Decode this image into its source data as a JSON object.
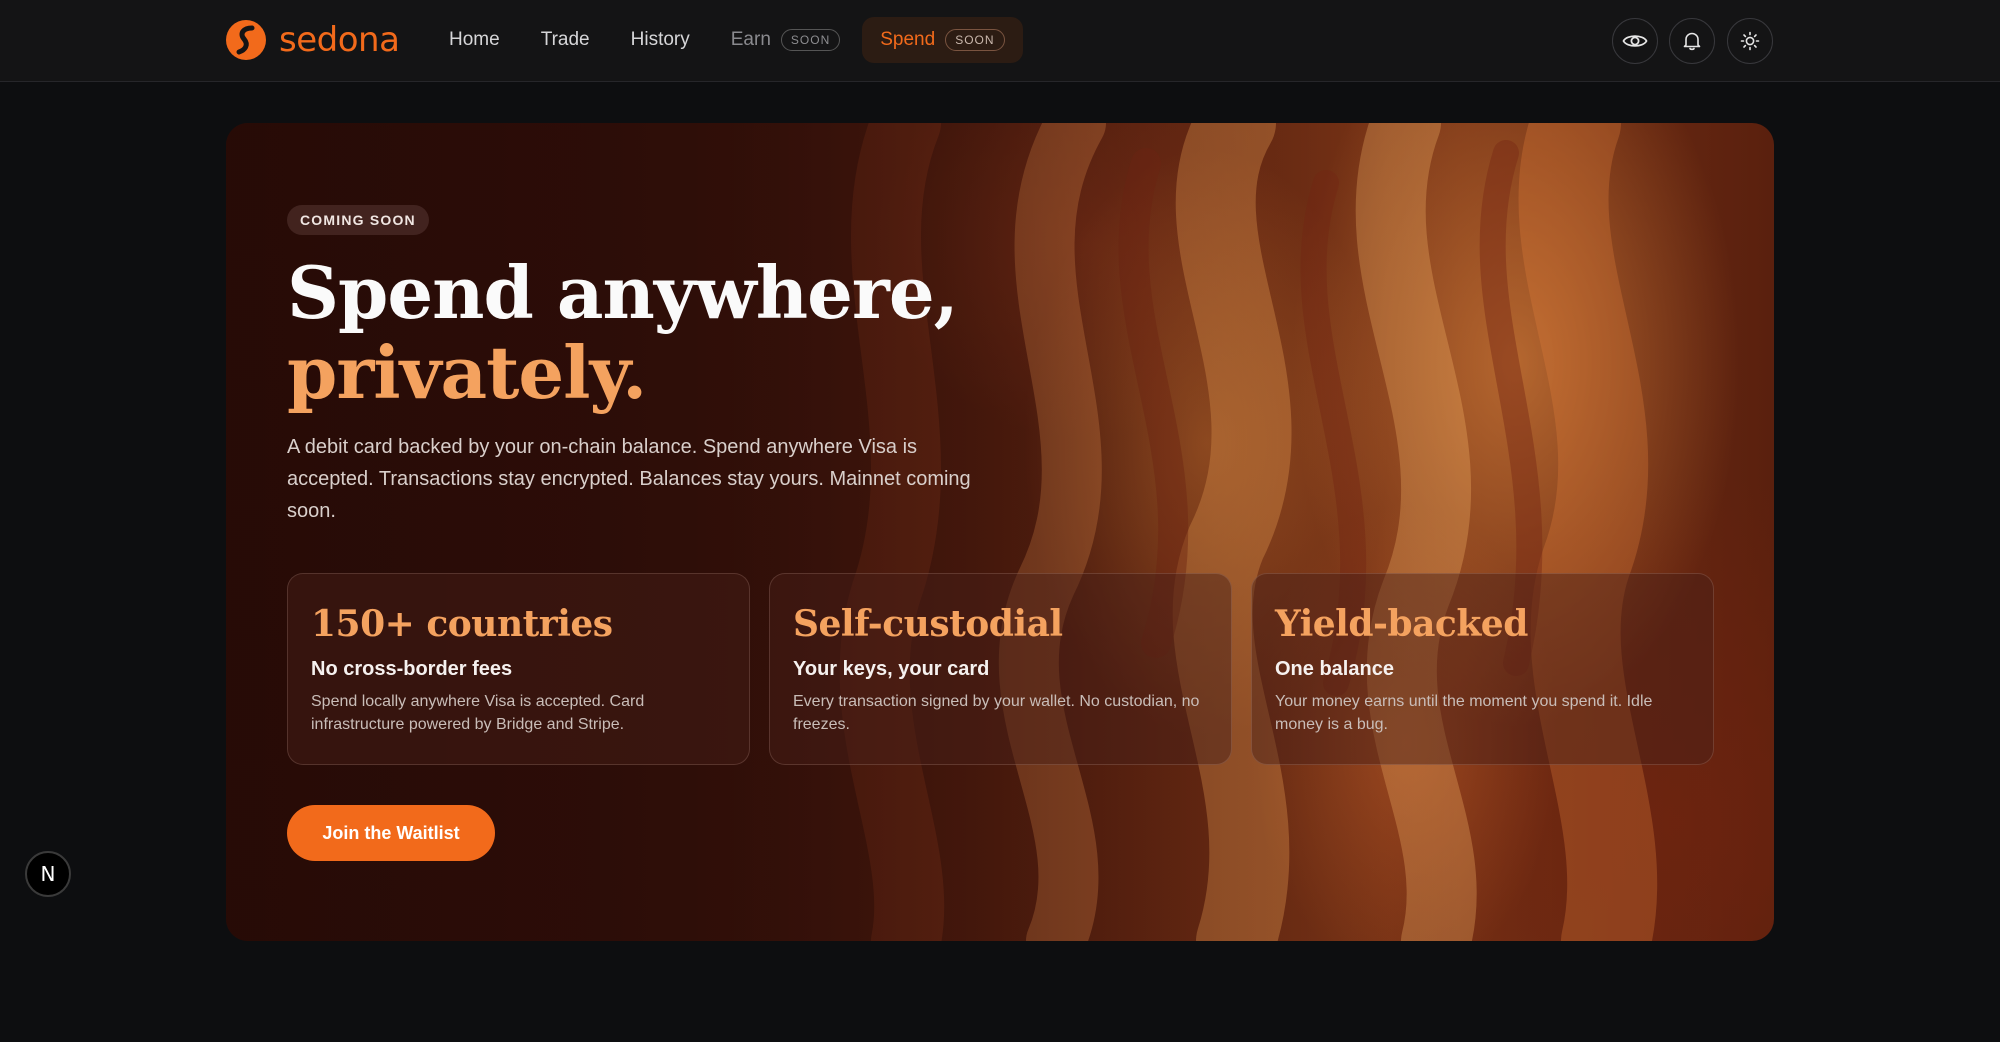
{
  "brand": {
    "name": "sedona",
    "accent": "#f26a1b"
  },
  "nav": {
    "items": [
      {
        "label": "Home"
      },
      {
        "label": "Trade"
      },
      {
        "label": "History"
      },
      {
        "label": "Earn",
        "badge": "SOON"
      },
      {
        "label": "Spend",
        "badge": "SOON",
        "active": true
      }
    ]
  },
  "toolbar": {
    "icons": [
      "eye-icon",
      "bell-icon",
      "sun-icon"
    ]
  },
  "hero": {
    "badge": "COMING SOON",
    "headline_line1": "Spend anywhere,",
    "headline_line2": "privately.",
    "lede": "A debit card backed by your on-chain balance. Spend anywhere Visa is accepted. Transactions stay encrypted. Balances stay yours. Mainnet coming soon.",
    "features": [
      {
        "title": "150+ countries",
        "subtitle": "No cross-border fees",
        "description": "Spend locally anywhere Visa is accepted. Card infrastructure powered by Bridge and Stripe."
      },
      {
        "title": "Self-custodial",
        "subtitle": "Your keys, your card",
        "description": "Every transaction signed by your wallet. No custodian, no freezes."
      },
      {
        "title": "Yield-backed",
        "subtitle": "One balance",
        "description": "Your money earns until the moment you spend it. Idle money is a bug."
      }
    ],
    "cta_label": "Join the Waitlist"
  },
  "dev_badge": {
    "label": "N"
  },
  "colors": {
    "background": "#0d0e10",
    "topbar": "#141415",
    "accent_title": "#f4a25f",
    "cta": "#f26a1b"
  }
}
